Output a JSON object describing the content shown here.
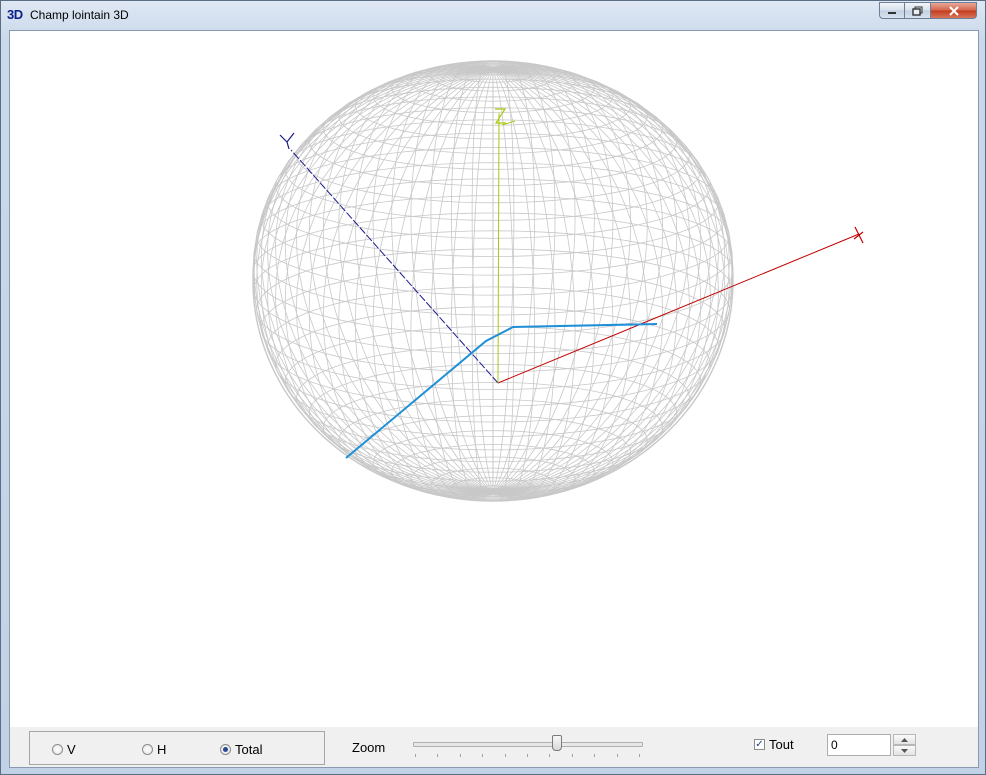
{
  "window": {
    "app_icon": "3D",
    "title": "Champ lointain 3D",
    "minimize_icon": "minimize-icon",
    "maximize_icon": "maximize-icon",
    "close_icon": "close-icon"
  },
  "plot3d": {
    "axes": [
      {
        "name": "X",
        "label": "X",
        "color": "#c00000"
      },
      {
        "name": "Y",
        "label": "Y",
        "color": "#1a1a8c"
      },
      {
        "name": "Z",
        "label": "Z",
        "color": "#a8c810"
      }
    ],
    "mesh_color": "#c8c8c8",
    "pattern_color": "#1e90d8"
  },
  "controls": {
    "polarization_options": [
      {
        "label": "V",
        "checked": false
      },
      {
        "label": "H",
        "checked": false
      },
      {
        "label": "Total",
        "checked": true
      }
    ],
    "zoom_label": "Zoom",
    "zoom_value": 0.63,
    "all_label": "Tout",
    "all_checked": true,
    "spin_value": "0"
  }
}
